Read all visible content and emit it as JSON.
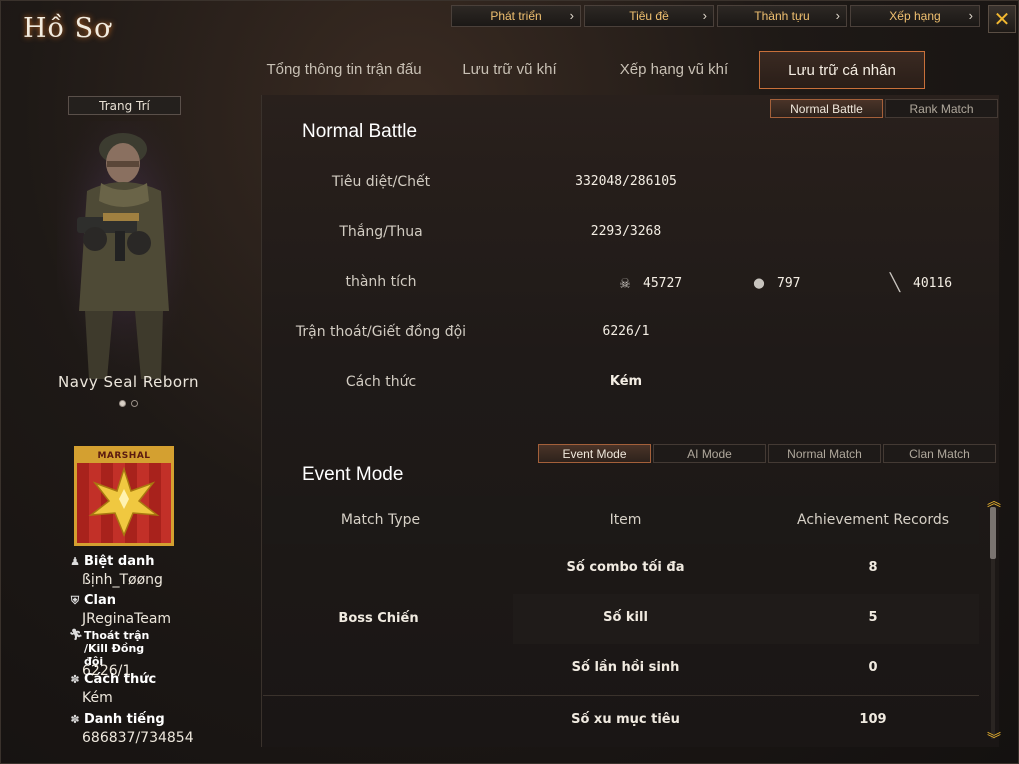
{
  "window": {
    "title": "Hồ Sơ"
  },
  "top_nav": {
    "items": [
      {
        "label": "Phát triển"
      },
      {
        "label": "Tiêu đề"
      },
      {
        "label": "Thành tựu"
      },
      {
        "label": "Xếp hạng"
      }
    ],
    "chevron": "›",
    "close_label": "✕"
  },
  "main_tabs": [
    {
      "label": "Tổng thông tin trận đấu",
      "active": false
    },
    {
      "label": "Lưu trữ vũ khí",
      "active": false
    },
    {
      "label": "Xếp hạng vũ khí",
      "active": false
    },
    {
      "label": "Lưu trữ cá nhân",
      "active": true
    }
  ],
  "left_panel": {
    "decor_button": "Trang Trí",
    "character_name": "Navy Seal Reborn",
    "carousel": {
      "current": 1,
      "total": 2
    },
    "rank": {
      "title": "MARSHAL"
    },
    "info": [
      {
        "icon": "person-icon",
        "label": "Biệt danh",
        "value": "ßịnh_Tøøng"
      },
      {
        "icon": "clan-shield-icon",
        "label": "Clan",
        "value": "JReginaTeam"
      },
      {
        "icon": "runner-icon",
        "label": "Thoát trận /Kill Đồng đội",
        "value": "6226/1"
      },
      {
        "icon": "gear-flower-icon",
        "label": "Cách thức",
        "value": "Kém"
      },
      {
        "icon": "gear-flower-icon",
        "label": "Danh tiếng",
        "value": "686837/734854"
      }
    ]
  },
  "normal_battle": {
    "mode_tabs": [
      {
        "label": "Normal Battle",
        "active": true
      },
      {
        "label": "Rank Match",
        "active": false
      }
    ],
    "title": "Normal Battle",
    "rows": {
      "kd": {
        "label": "Tiêu diệt/Chết",
        "value": "332048/286105"
      },
      "winloss": {
        "label": "Thắng/Thua",
        "value": "2293/3268"
      },
      "achievements": {
        "label": "thành tích",
        "items": [
          {
            "icon": "skull-crossbones-icon",
            "value": "45727"
          },
          {
            "icon": "grenade-icon",
            "value": "797"
          },
          {
            "icon": "knife-icon",
            "value": "40116"
          }
        ]
      },
      "escape": {
        "label": "Trận thoát/Giết đồng đội",
        "value": "6226/1"
      },
      "manner": {
        "label": "Cách thức",
        "value": "Kém"
      }
    }
  },
  "event_mode": {
    "mode_tabs": [
      {
        "label": "Event Mode",
        "active": true
      },
      {
        "label": "AI Mode",
        "active": false
      },
      {
        "label": "Normal Match",
        "active": false
      },
      {
        "label": "Clan Match",
        "active": false
      }
    ],
    "title": "Event Mode",
    "columns": [
      "Match Type",
      "Item",
      "Achievement Records"
    ],
    "match_type": "Boss Chiến",
    "rows": [
      {
        "item": "Số combo tối đa",
        "record": "8"
      },
      {
        "item": "Số kill",
        "record": "5"
      },
      {
        "item": "Số lần hồi sinh",
        "record": "0"
      },
      {
        "item": "Số xu mục tiêu",
        "record": "109"
      }
    ]
  },
  "colors": {
    "accent": "#c8703a",
    "gold": "#f0b830",
    "rank_red": "#b52a22"
  }
}
